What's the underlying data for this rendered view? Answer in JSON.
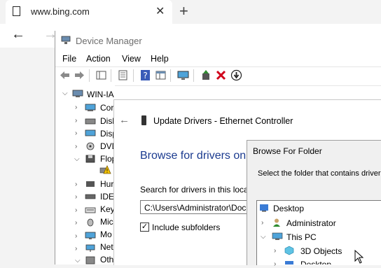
{
  "browser": {
    "tab_title": "www.bing.com",
    "close_glyph": "✕",
    "new_tab_glyph": "+",
    "back_glyph": "←",
    "forward_glyph": "→"
  },
  "device_manager": {
    "title": "Device Manager",
    "menu": [
      "File",
      "Action",
      "View",
      "Help"
    ],
    "toolbar_icons": [
      "back-icon",
      "forward-icon",
      "show-hide-tree-icon",
      "properties-icon",
      "help-icon",
      "action-icon",
      "monitor-icon",
      "update-driver-icon",
      "uninstall-icon",
      "disable-icon"
    ],
    "tree": {
      "root": "WIN-IA",
      "items": [
        "Cor",
        "Disk",
        "Disp",
        "DVD",
        "Flop",
        "",
        "Hur",
        "IDE",
        "Key",
        "Mic",
        "Mo",
        "Net",
        "Oth"
      ]
    }
  },
  "update_drivers": {
    "title": "Update Drivers - Ethernet Controller",
    "heading": "Browse for drivers on",
    "search_label": "Search for drivers in this loca",
    "path_value": "C:\\Users\\Administrator\\Doc",
    "include_subfolders_label": "Include subfolders",
    "include_subfolders_checked": true,
    "back_glyph": "←"
  },
  "browse_folder": {
    "title": "Browse For Folder",
    "prompt": "Select the folder that contains driver",
    "tree": [
      {
        "label": "Desktop"
      },
      {
        "label": "Administrator"
      },
      {
        "label": "This PC"
      },
      {
        "label": "3D Objects"
      },
      {
        "label": "Desktop"
      }
    ]
  },
  "colors": {
    "heading_blue": "#1a3a8f",
    "error_red": "#d0021b",
    "green": "#2e8b2e"
  }
}
